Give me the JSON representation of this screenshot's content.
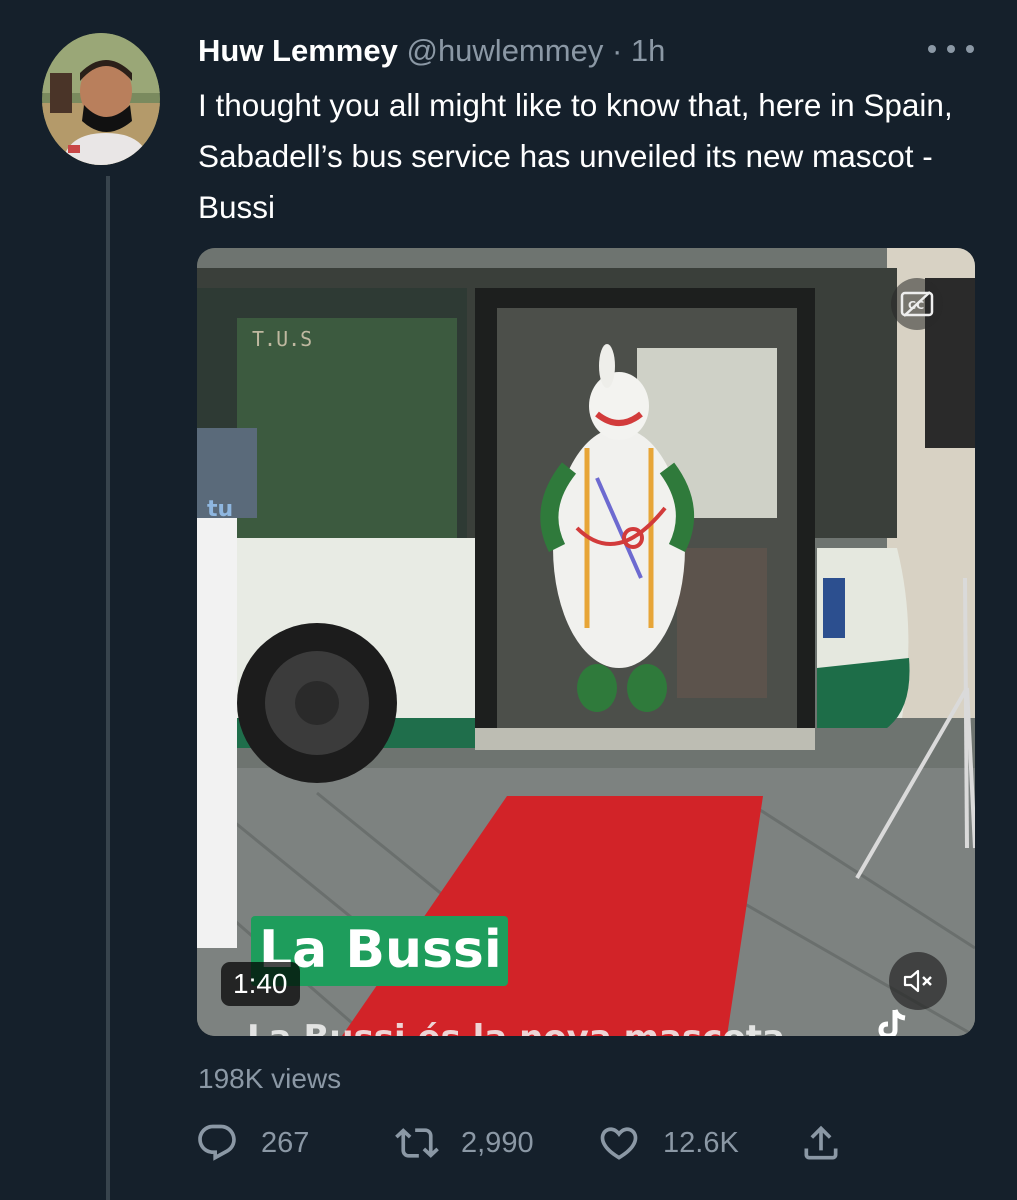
{
  "tweet": {
    "author_name": "Huw Lemmey",
    "handle": "@huwlemmey",
    "separator": "·",
    "time": "1h",
    "text": "I thought you all might like to know that, here in Spain, Sabadell’s bus service has unveiled its new mascot - Bussi",
    "views": "198K views"
  },
  "media": {
    "duration": "1:40",
    "caption": "La Bussi",
    "subcaption": "La Bussi és la nova mascota",
    "bus_sign": "T.U.S",
    "bus_brand": "tu"
  },
  "actions": {
    "replies": "267",
    "retweets": "2,990",
    "likes": "12.6K"
  },
  "icons": {
    "more": "more-horizontal-icon",
    "cc": "closed-captions-icon",
    "mute": "volume-muted-icon",
    "reply": "reply-icon",
    "retweet": "retweet-icon",
    "like": "heart-icon",
    "share": "share-icon",
    "watermark": "tiktok-logo-icon"
  },
  "colors": {
    "background": "#15202b",
    "secondary_text": "#8b98a5",
    "caption_bg": "#1e9d5c"
  }
}
